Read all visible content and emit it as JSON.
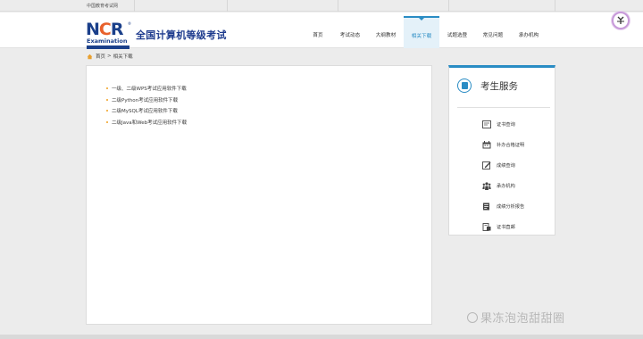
{
  "topbar": {
    "site_name": "中国教育考试网"
  },
  "header": {
    "logo": {
      "mark_n": "N",
      "mark_c": "C",
      "mark_r": "R",
      "sub": "Examination",
      "reg": "®"
    },
    "brand": "全国计算机等级考试"
  },
  "nav": {
    "items": [
      {
        "label": "首页",
        "active": false
      },
      {
        "label": "考试动态",
        "active": false
      },
      {
        "label": "大纲教材",
        "active": false
      },
      {
        "label": "相关下载",
        "active": true
      },
      {
        "label": "试题选登",
        "active": false
      },
      {
        "label": "常见问题",
        "active": false
      },
      {
        "label": "承办机构",
        "active": false
      }
    ]
  },
  "breadcrumb": {
    "home": "首页",
    "sep": ">",
    "current": "相关下载"
  },
  "downloads": [
    {
      "label": "一级、二级WPS考试应用软件下载"
    },
    {
      "label": "二级Python考试应用软件下载"
    },
    {
      "label": "二级MySQL考试应用软件下载"
    },
    {
      "label": "二级Java和Web考试应用软件下载"
    }
  ],
  "service": {
    "title": "考生服务",
    "items": [
      {
        "label": "证书查询",
        "icon": "certificate-icon"
      },
      {
        "label": "补办合格证明",
        "icon": "calendar-icon"
      },
      {
        "label": "成绩查询",
        "icon": "edit-icon"
      },
      {
        "label": "承办机构",
        "icon": "people-icon"
      },
      {
        "label": "成绩分析报告",
        "icon": "report-icon"
      },
      {
        "label": "证书直邮",
        "icon": "mail-icon"
      }
    ]
  },
  "watermark": {
    "text": "果冻泡泡甜甜圈"
  },
  "colors": {
    "accent": "#2a8cc4",
    "brand": "#1f3c8e",
    "logo_orange": "#e8612c",
    "bullet": "#f0a020"
  }
}
